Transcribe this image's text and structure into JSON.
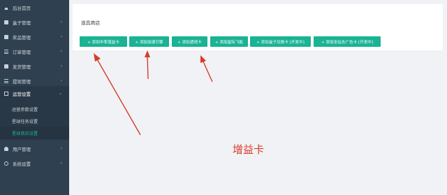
{
  "sidebar": {
    "items": [
      {
        "label": "后台首页",
        "icon": "home-icon",
        "chevron": ""
      },
      {
        "label": "盒子管理",
        "icon": "box-icon",
        "chevron": "›"
      },
      {
        "label": "奖品管理",
        "icon": "gift-icon",
        "chevron": "›"
      },
      {
        "label": "订单管理",
        "icon": "order-icon",
        "chevron": "›"
      },
      {
        "label": "发货管理",
        "icon": "truck-icon",
        "chevron": "›"
      },
      {
        "label": "提现管理",
        "icon": "withdraw-icon",
        "chevron": "›"
      },
      {
        "label": "运营设置",
        "icon": "monitor-icon",
        "chevron": "⌄"
      },
      {
        "label": "用户管理",
        "icon": "user-icon",
        "chevron": "›"
      },
      {
        "label": "系统设置",
        "icon": "gear-icon",
        "chevron": "›"
      }
    ],
    "subitems": [
      {
        "label": "运营参数设置"
      },
      {
        "label": "星球任务设置"
      },
      {
        "label": "星球商店设置"
      }
    ]
  },
  "main": {
    "title": "道具商店",
    "buttons": [
      {
        "label": "+ 添加中率增益卡"
      },
      {
        "label": "+ 添加加速引擎"
      },
      {
        "label": "+ 添加透视卡"
      },
      {
        "label": "+ 添加星际飞船"
      },
      {
        "label": "+ 添加盒子兑换卡 [开发中]"
      },
      {
        "label": "+ 添加全站去广告卡 [开发中]"
      }
    ]
  },
  "annotation": {
    "text": "增益卡",
    "color": "#d93a2b"
  },
  "colors": {
    "sidebar_bg": "#2f4050",
    "accent": "#1ab394",
    "page_bg": "#f0f2f5"
  }
}
